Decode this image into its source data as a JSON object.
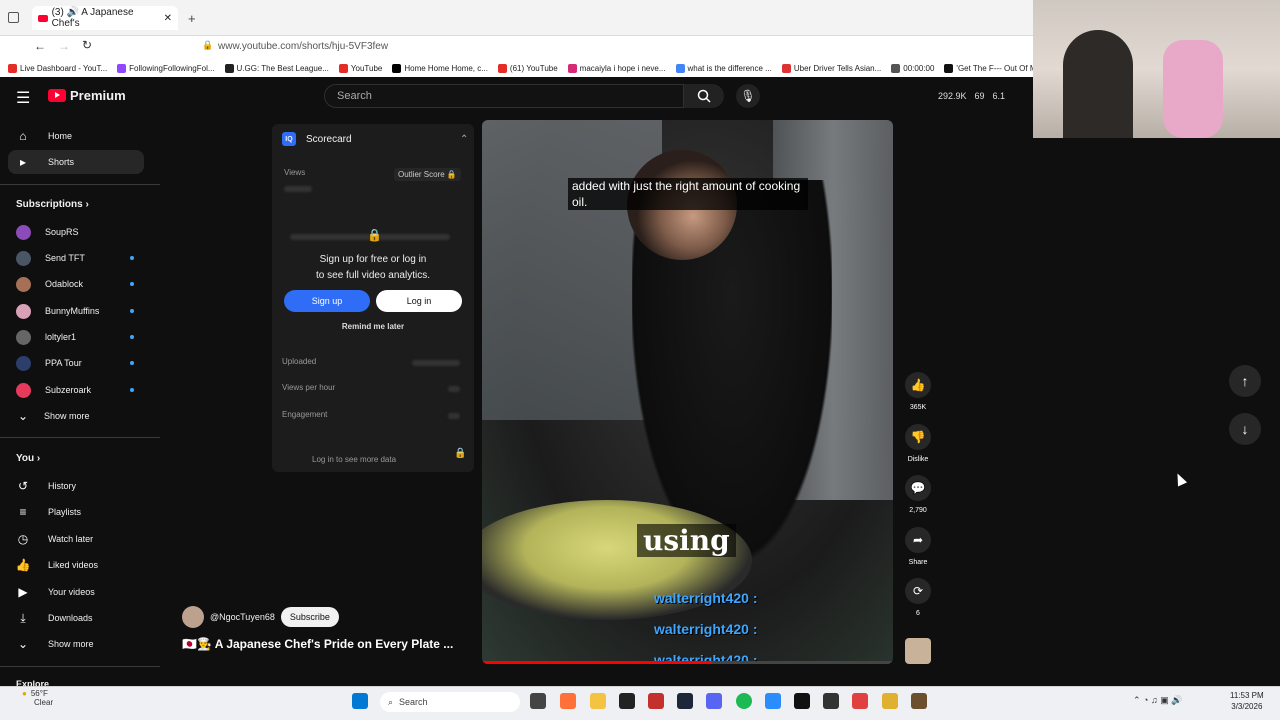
{
  "browser": {
    "tab_title": "(3) 🔊 A Japanese Chef's",
    "url": "www.youtube.com/shorts/hju-5VF3few",
    "bookmarks": [
      "Live Dashboard - YouT...",
      "FollowingFollowingFol...",
      "U.GG: The Best League...",
      "YouTube",
      "Home Home Home, c...",
      "(61) YouTube",
      "macaiyla i hope i neve...",
      "what is the difference ...",
      "Uber Driver Tells Asian...",
      "00:00:00",
      "'Get The F--- Out Of M..."
    ]
  },
  "header": {
    "brand": "Premium",
    "search_placeholder": "Search",
    "stats": [
      "292.9K",
      "69",
      "6.1"
    ]
  },
  "sidebar": {
    "items": [
      {
        "label": "Home",
        "icon": "home-icon"
      },
      {
        "label": "Shorts",
        "icon": "shorts-icon"
      }
    ],
    "subscriptions_heading": "Subscriptions",
    "subscriptions": [
      {
        "label": "SoupRS",
        "color": "#8b4bb8",
        "dot": false
      },
      {
        "label": "Send TFT",
        "color": "#4a5566",
        "dot": true
      },
      {
        "label": "Odablock",
        "color": "#a57055",
        "dot": true
      },
      {
        "label": "BunnyMuffins",
        "color": "#d9a1b5",
        "dot": true
      },
      {
        "label": "loltyler1",
        "color": "#666666",
        "dot": true
      },
      {
        "label": "PPA Tour",
        "color": "#2c3e6a",
        "dot": true
      },
      {
        "label": "Subzeroark",
        "color": "#e6395c",
        "dot": true
      }
    ],
    "show_more": "Show more",
    "you_heading": "You",
    "you_items": [
      {
        "label": "History",
        "icon": "history-icon"
      },
      {
        "label": "Playlists",
        "icon": "playlists-icon"
      },
      {
        "label": "Watch later",
        "icon": "watch-later-icon"
      },
      {
        "label": "Liked videos",
        "icon": "like-icon"
      },
      {
        "label": "Your videos",
        "icon": "your-videos-icon"
      },
      {
        "label": "Downloads",
        "icon": "download-icon"
      }
    ],
    "show_more_2": "Show more",
    "explore_heading": "Explore"
  },
  "scorecard": {
    "title": "Scorecard",
    "views_label": "Views",
    "outlier": "Outlier Score 🔒",
    "signup_line1": "Sign up for free or log in",
    "signup_line2": "to see full video analytics.",
    "signup_button": "Sign up",
    "login_button": "Log in",
    "remind": "Remind me later",
    "uploaded": "Uploaded",
    "views_per_hour": "Views per hour",
    "engagement": "Engagement",
    "login_more": "Log in to see more data"
  },
  "video": {
    "caption_top": "added with just the right amount of cooking oil.",
    "caption_big": "using",
    "chat_lines": [
      "walterright420 :",
      "walterright420 :",
      "walterright420 :"
    ],
    "progress": 0.56
  },
  "actions": {
    "likes": "365K",
    "dislike": "Dislike",
    "comments": "2,790",
    "share": "Share",
    "remix": "6"
  },
  "channel": {
    "name": "@NgocTuyen68",
    "subscribe": "Subscribe",
    "title": "🇯🇵👨‍🍳 A Japanese Chef's Pride on Every Plate ..."
  },
  "taskbar": {
    "temp": "56°F",
    "weather": "Clear",
    "search": "Search",
    "time": "11:53 PM",
    "date": "3/3/2026"
  }
}
